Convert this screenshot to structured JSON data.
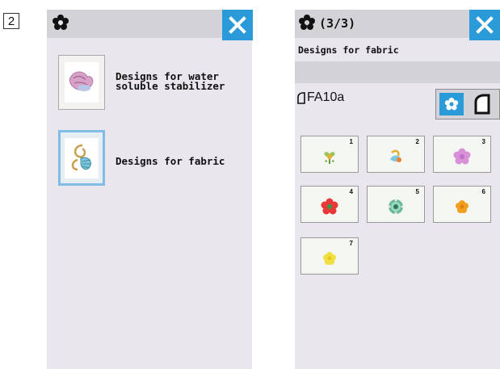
{
  "step": {
    "number": "2"
  },
  "left_screen": {
    "designs": [
      {
        "label_line1": "Designs for water",
        "label_line2": "soluble stabilizer",
        "selected": false
      },
      {
        "label_line1": "Designs for fabric",
        "label_line2": "",
        "selected": true
      }
    ]
  },
  "right_screen": {
    "page_indicator": "(3/3)",
    "subtitle": "Designs for fabric",
    "folder_name": "FA10a",
    "tiles": [
      {
        "num": "1",
        "icon": "heart-flower"
      },
      {
        "num": "2",
        "icon": "bird-ribbon"
      },
      {
        "num": "3",
        "icon": "pink-flower"
      },
      {
        "num": "4",
        "icon": "red-flower"
      },
      {
        "num": "5",
        "icon": "green-rosette"
      },
      {
        "num": "6",
        "icon": "orange-flower"
      },
      {
        "num": "7",
        "icon": "yellow-flower"
      }
    ]
  },
  "colors": {
    "accent": "#2a9bd8",
    "screen_bg": "#e9e6ee",
    "title_bar": "#d3d2d6"
  }
}
